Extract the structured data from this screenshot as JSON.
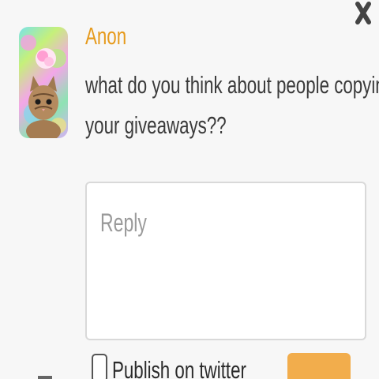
{
  "dialog": {
    "close_icon": "close-icon"
  },
  "question": {
    "author": "Anon",
    "avatar_icon": "kitten-avatar",
    "text_line1": "what do you think about people copying",
    "text_line2": "your giveaways??"
  },
  "reply": {
    "placeholder": "Reply",
    "value": ""
  },
  "options": {
    "publish_twitter_label": "Publish on twitter",
    "publish_twitter_checked": false
  },
  "colors": {
    "author": "#e69a1c",
    "button": "#f2ad4c",
    "background": "#f7f7f7"
  }
}
